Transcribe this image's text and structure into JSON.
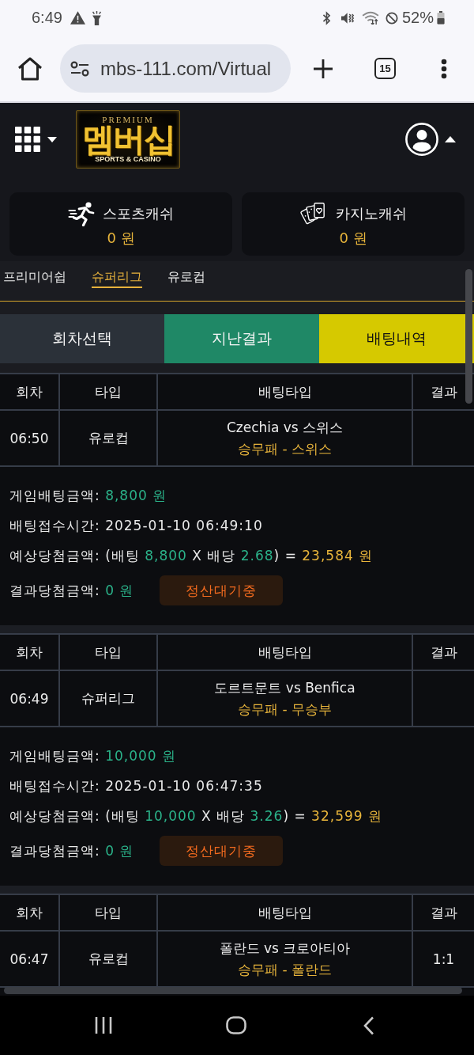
{
  "status_bar": {
    "time": "6:49",
    "battery": "52%"
  },
  "browser": {
    "url": "mbs-111.com/Virtual",
    "tab_count": "15"
  },
  "logo": {
    "top_line": "PREMIUM",
    "name": "멤버십",
    "tagline": "SPORTS & CASINO"
  },
  "wallets": [
    {
      "kind": "sports",
      "label": "스포츠캐쉬",
      "amount": "0 원"
    },
    {
      "kind": "casino",
      "label": "카지노캐쉬",
      "amount": "0 원"
    }
  ],
  "league_tabs": [
    {
      "label": "프리미어쉽",
      "selected": false
    },
    {
      "label": "슈퍼리그",
      "selected": true
    },
    {
      "label": "유로컵",
      "selected": false
    }
  ],
  "action_tabs": [
    {
      "label": "회차선택",
      "color": "#2b3139"
    },
    {
      "label": "지난결과",
      "color": "#1f8866"
    },
    {
      "label": "배팅내역",
      "color": "#d6c900"
    }
  ],
  "bets": [
    {
      "columns": [
        "회차",
        "타입",
        "배팅타입",
        "결과"
      ],
      "round": "06:50",
      "type": "유로컵",
      "match": "Czechia vs 스위스",
      "pick": "승무패 - 스위스",
      "bet_amount": {
        "label": "게임배팅금액:",
        "value": "8,800 원"
      },
      "bet_time": {
        "label": "배팅접수시간:",
        "value": "2025-01-10 06:49:10"
      },
      "expected_win": {
        "label": "예상당첨금액:",
        "open": "(배팅",
        "stake": "8,800",
        "times": "X",
        "odds_label": "배당",
        "odds": "2.68",
        "close": ")",
        "equals": "=",
        "payout": "23,584 원"
      },
      "result_amount": {
        "label": "결과당첨금액:",
        "value": "0 원"
      },
      "status": "정산대기중"
    },
    {
      "columns": [
        "회차",
        "타입",
        "배팅타입",
        "결과"
      ],
      "round": "06:49",
      "type": "슈퍼리그",
      "match": "도르트문트 vs Benfica",
      "pick": "승무패 - 무승부",
      "bet_amount": {
        "label": "게임배팅금액:",
        "value": "10,000 원"
      },
      "bet_time": {
        "label": "배팅접수시간:",
        "value": "2025-01-10 06:47:35"
      },
      "expected_win": {
        "label": "예상당첨금액:",
        "open": "(배팅",
        "stake": "10,000",
        "times": "X",
        "odds_label": "배당",
        "odds": "3.26",
        "close": ")",
        "equals": "=",
        "payout": "32,599 원"
      },
      "result_amount": {
        "label": "결과당첨금액:",
        "value": "0 원"
      },
      "status": "정산대기중"
    },
    {
      "columns": [
        "회차",
        "타입",
        "배팅타입",
        "결과"
      ],
      "round": "06:47",
      "type": "유로컵",
      "match": "폴란드 vs 크로아티아",
      "pick": "승무패 - 폴란드",
      "result": "1:1"
    }
  ]
}
